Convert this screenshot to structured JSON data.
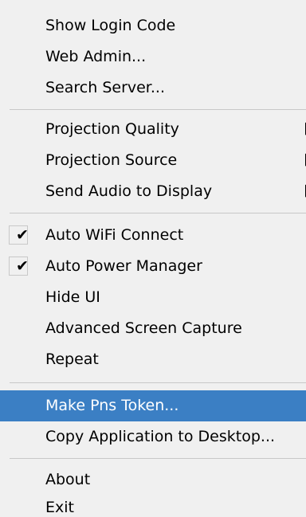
{
  "menu": {
    "items": [
      {
        "label": "Show Login Code"
      },
      {
        "label": "Web Admin..."
      },
      {
        "label": "Search Server..."
      },
      {
        "label": "Projection Quality",
        "submenu_marker": "▐"
      },
      {
        "label": "Projection Source",
        "submenu_marker": "▐"
      },
      {
        "label": "Send Audio to Display",
        "submenu_marker": "▐"
      },
      {
        "label": "Auto WiFi Connect",
        "check": "✔"
      },
      {
        "label": "Auto Power Manager",
        "check": "✔"
      },
      {
        "label": "Hide UI"
      },
      {
        "label": "Advanced Screen Capture"
      },
      {
        "label": "Repeat"
      },
      {
        "label": "Make Pns Token..."
      },
      {
        "label": "Copy Application to Desktop..."
      },
      {
        "label": "About"
      },
      {
        "label": "Exit"
      }
    ],
    "highlighted_item": "Make Pns Token...",
    "highlight_color": "#3b7fc4"
  }
}
